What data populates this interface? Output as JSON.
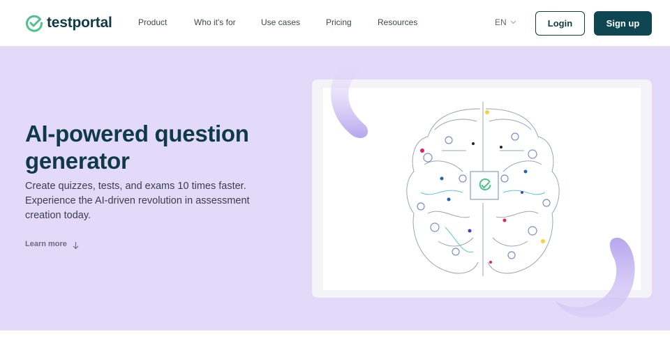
{
  "header": {
    "brand": "testportal",
    "nav": [
      {
        "label": "Product"
      },
      {
        "label": "Who it's for"
      },
      {
        "label": "Use cases"
      },
      {
        "label": "Pricing"
      },
      {
        "label": "Resources"
      }
    ],
    "language": "EN",
    "login_label": "Login",
    "signup_label": "Sign up"
  },
  "hero": {
    "title": "AI-powered question generator",
    "description": "Create quizzes, tests, and exams 10 times faster. Experience the AI-driven revolution in assessment creation today.",
    "learn_more": "Learn more",
    "illustration": "circuit-brain-with-checkmark-chip"
  },
  "colors": {
    "brand_dark": "#0e3b46",
    "brand_green": "#4cc38a",
    "hero_bg": "#e3dafa",
    "accent_purple": "#b7a6ee"
  }
}
